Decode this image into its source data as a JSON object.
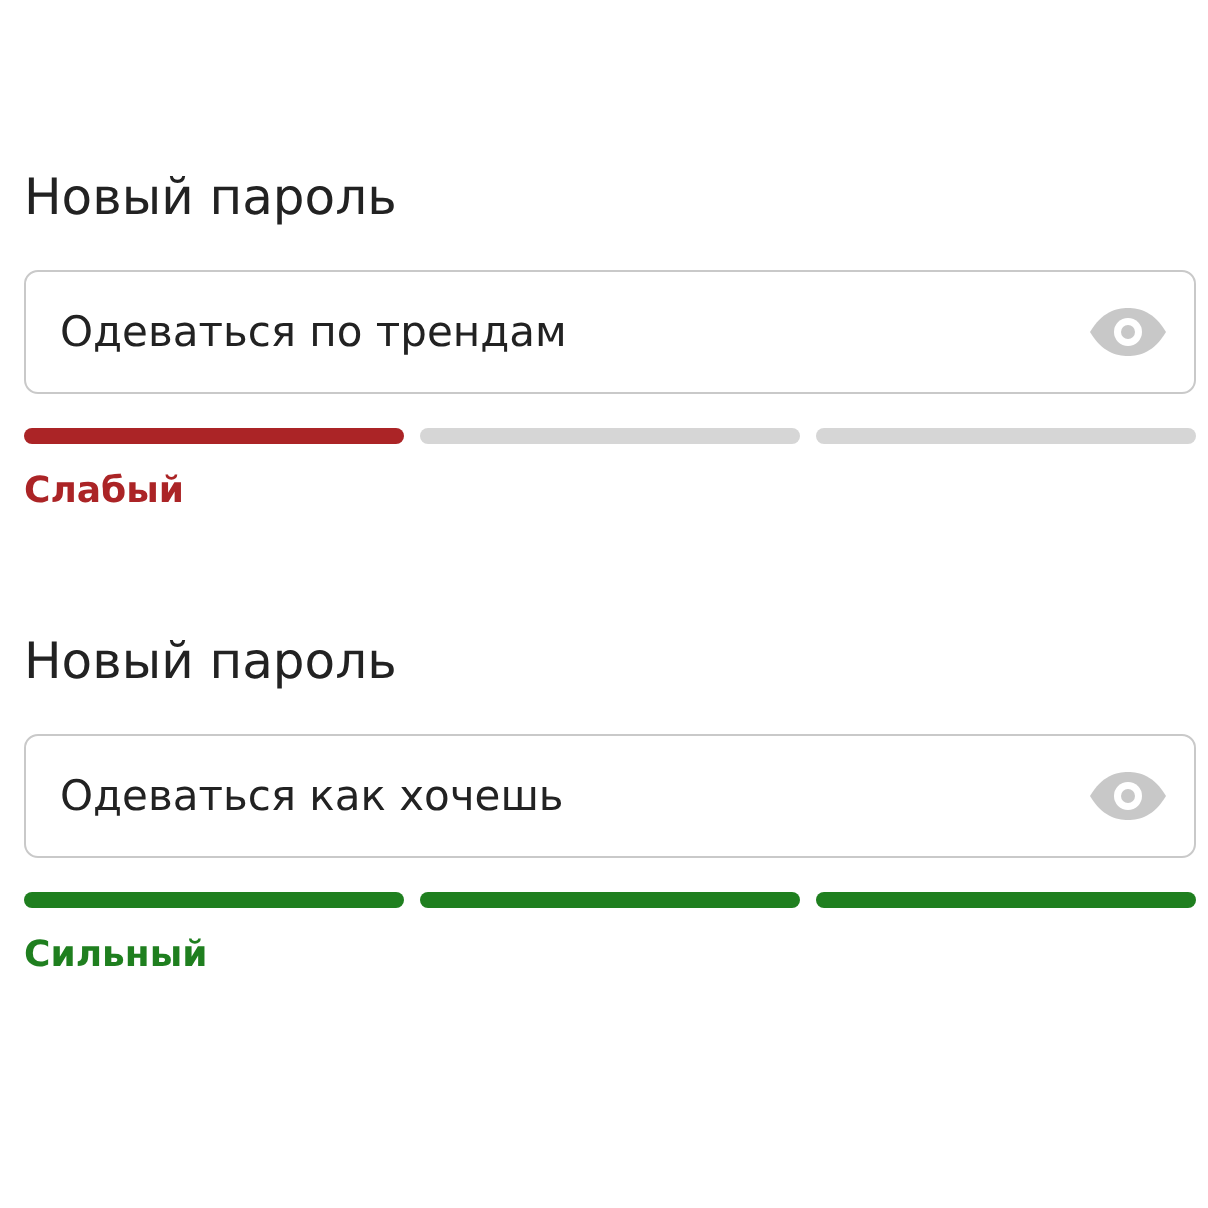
{
  "password_fields": [
    {
      "label": "Новый пароль",
      "value": "Одеваться по трендам",
      "strength_label": "Слабый",
      "color": "#ab2426",
      "segments": [
        {
          "on": true
        },
        {
          "on": false
        },
        {
          "on": false
        }
      ]
    },
    {
      "label": "Новый пароль",
      "value": "Одеваться как хочешь",
      "strength_label": "Сильный",
      "color": "#1f7f1f",
      "segments": [
        {
          "on": true
        },
        {
          "on": true
        },
        {
          "on": true
        }
      ]
    }
  ]
}
